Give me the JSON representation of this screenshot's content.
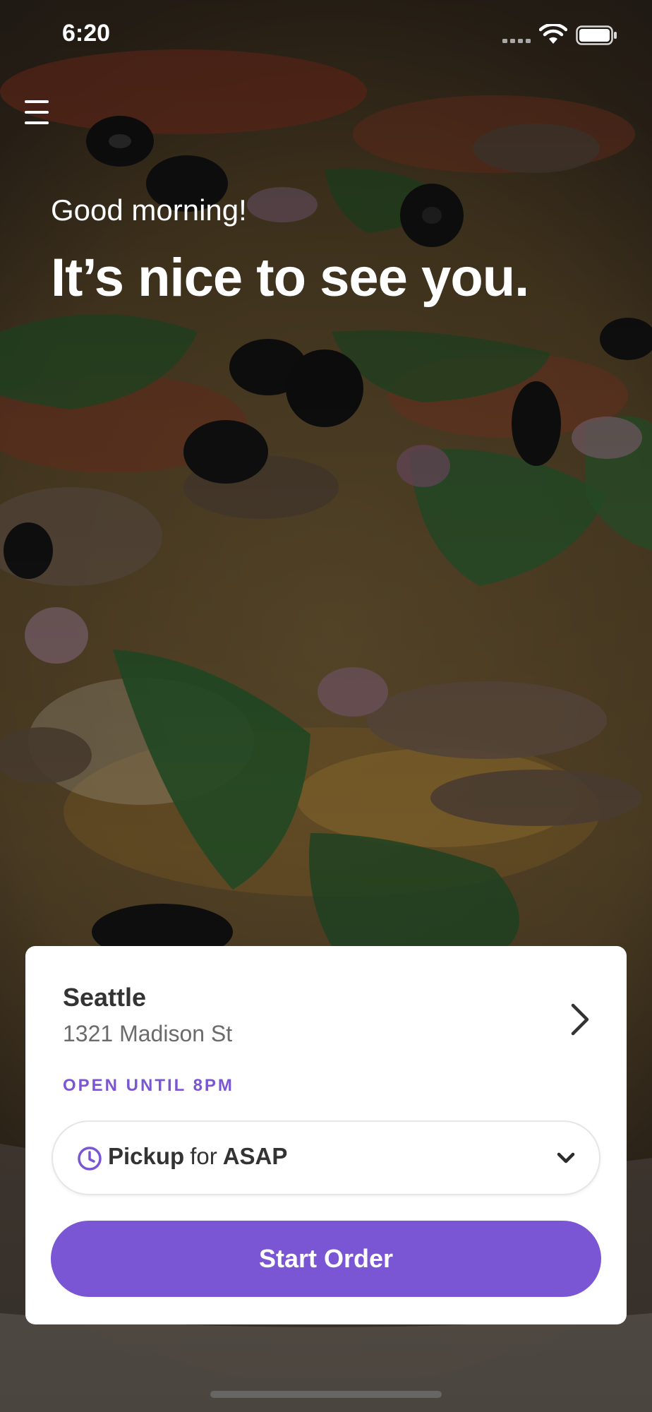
{
  "status_bar": {
    "time": "6:20"
  },
  "icons": {
    "menu": "hamburger-menu-icon",
    "location_chevron": "chevron-right-icon",
    "pickup_clock": "clock-icon",
    "dropdown": "chevron-down-icon"
  },
  "hero": {
    "greeting": "Good morning!",
    "title": "It’s nice to see you."
  },
  "location": {
    "name": "Seattle",
    "address": "1321 Madison St",
    "hours": "OPEN UNTIL 8PM"
  },
  "pickup": {
    "mode": "Pickup",
    "connector": "for",
    "time": "ASAP"
  },
  "actions": {
    "start_order": "Start Order"
  },
  "colors": {
    "accent": "#7b56d4",
    "card_background": "#ffffff",
    "text_dark": "#333333",
    "text_muted": "#6b6b6b"
  }
}
